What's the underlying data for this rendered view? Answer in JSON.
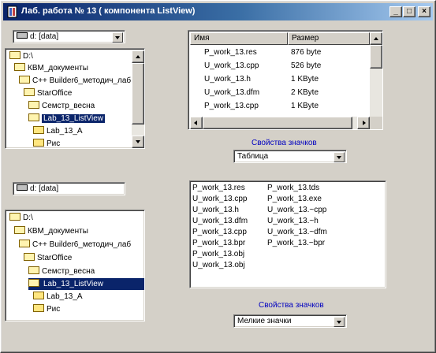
{
  "window": {
    "title": "Лаб. работа № 13 ( компонента ListView)",
    "buttons": {
      "minimize": "_",
      "maximize": "□",
      "close": "×"
    }
  },
  "top_panel": {
    "drive_combo": {
      "value": "d: [data]"
    },
    "tree": [
      {
        "label": "D:\\",
        "icon": "folder-open-icon",
        "selected": false
      },
      {
        "label": "КВМ_документы",
        "icon": "folder-open-icon",
        "selected": false
      },
      {
        "label": "C++ Builder6_методич_лаб",
        "icon": "folder-open-icon",
        "selected": false
      },
      {
        "label": "StarOffice",
        "icon": "folder-open-icon",
        "selected": false
      },
      {
        "label": "Семстр_весна",
        "icon": "folder-open-icon",
        "selected": false
      },
      {
        "label": "Lab_13_ListView",
        "icon": "folder-open-icon",
        "selected": true
      },
      {
        "label": "Lab_13_A",
        "icon": "folder-icon",
        "selected": false
      },
      {
        "label": "Рис",
        "icon": "folder-icon",
        "selected": false
      }
    ]
  },
  "report_list": {
    "columns": [
      "Имя",
      "Размер"
    ],
    "rows": [
      {
        "name": "P_work_13.res",
        "size": "876 byte"
      },
      {
        "name": "U_work_13.cpp",
        "size": "526 byte"
      },
      {
        "name": "U_work_13.h",
        "size": "1 KByte"
      },
      {
        "name": "U_work_13.dfm",
        "size": "2 KByte"
      },
      {
        "name": "P_work_13.cpp",
        "size": "1 KByte"
      }
    ],
    "caption": "Свойства значков",
    "view_combo": {
      "value": "Таблица"
    }
  },
  "bottom_panel": {
    "drive_combo": {
      "value": "d: [data]"
    },
    "tree": [
      {
        "label": "D:\\",
        "icon": "folder-open-icon",
        "selected": false
      },
      {
        "label": "КВМ_документы",
        "icon": "folder-open-icon",
        "selected": false
      },
      {
        "label": "C++ Builder6_методич_лаб",
        "icon": "folder-open-icon",
        "selected": false
      },
      {
        "label": "StarOffice",
        "icon": "folder-open-icon",
        "selected": false
      },
      {
        "label": "Семстр_весна",
        "icon": "folder-open-icon",
        "selected": false
      },
      {
        "label": "Lab_13_ListView",
        "icon": "folder-open-icon",
        "selected": true
      },
      {
        "label": "Lab_13_A",
        "icon": "folder-icon",
        "selected": false
      },
      {
        "label": "Рис",
        "icon": "folder-icon",
        "selected": false
      }
    ]
  },
  "small_icons_list": {
    "col1": [
      "P_work_13.res",
      "U_work_13.cpp",
      "U_work_13.h",
      "U_work_13.dfm",
      "P_work_13.cpp",
      "P_work_13.bpr",
      "P_work_13.obj",
      "U_work_13.obj"
    ],
    "col2": [
      "P_work_13.tds",
      "P_work_13.exe",
      "U_work_13.~cpp",
      "U_work_13.~h",
      "U_work_13.~dfm",
      "P_work_13.~bpr"
    ],
    "caption": "Свойства значков",
    "view_combo": {
      "value": "Мелкие значки"
    }
  },
  "colors": {
    "title_start": "#0a246a",
    "title_end": "#a6caf0",
    "caption": "#0000c0",
    "selection": "#0a246a"
  }
}
